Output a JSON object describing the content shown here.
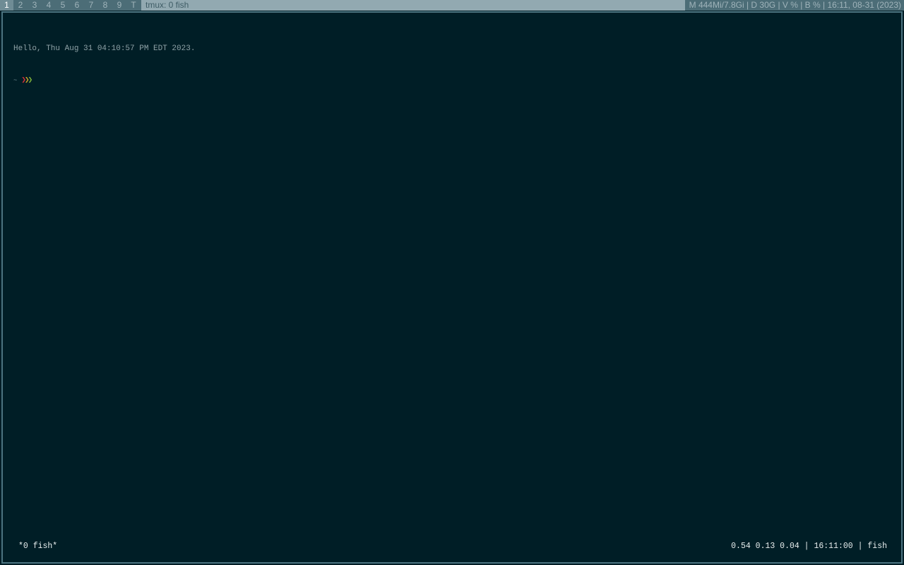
{
  "topbar": {
    "workspaces": [
      {
        "label": "1",
        "active": true
      },
      {
        "label": "2"
      },
      {
        "label": "3"
      },
      {
        "label": "4"
      },
      {
        "label": "5"
      },
      {
        "label": "6"
      },
      {
        "label": "7"
      },
      {
        "label": "8"
      },
      {
        "label": "9"
      },
      {
        "label": "T"
      }
    ],
    "window_title": "tmux: 0 fish",
    "sysinfo": "M 444Mi/7.8Gi | D 30G | V % | B % | 16:11, 08-31 (2023)"
  },
  "terminal": {
    "greeting": "Hello, Thu Aug 31 04:10:57 PM EDT 2023.",
    "prompt_dir": "~",
    "prompt_chevrons": [
      "❯",
      "❯",
      "❯"
    ]
  },
  "tmux": {
    "window_list": "*0 fish*",
    "status_right": "0.54 0.13 0.04 | 16:11:00 | fish"
  },
  "colors": {
    "background": "#001e26",
    "bar": "#4c6d77",
    "title_bg": "#92a9b1",
    "chevron_red": "#d8323a",
    "chevron_yellow": "#c9a225",
    "chevron_green": "#7fb53a"
  }
}
